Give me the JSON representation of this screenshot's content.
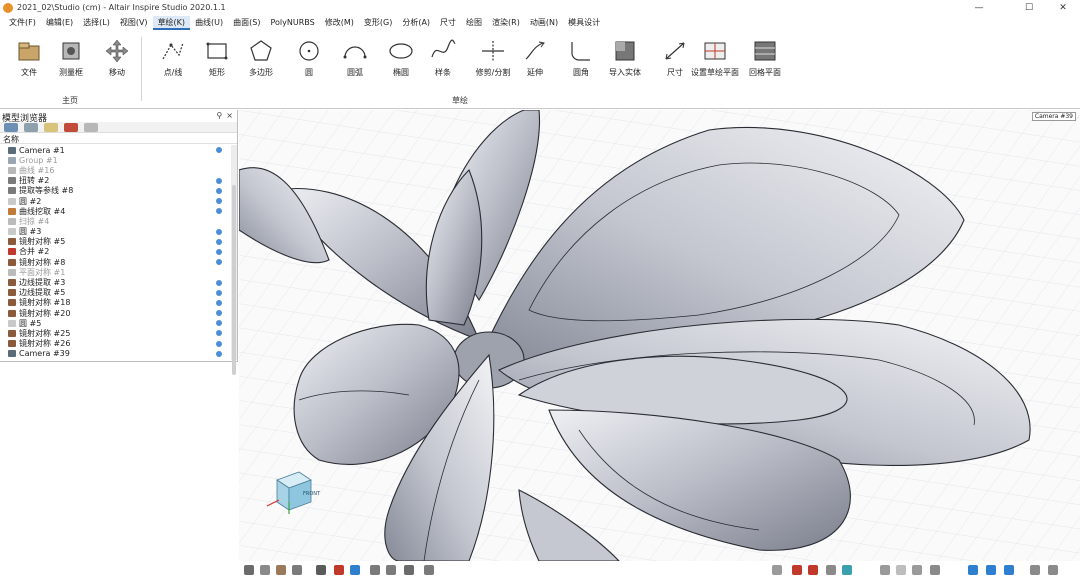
{
  "window": {
    "title": "2021_02\\Studio (cm) - Altair Inspire Studio 2020.1.1",
    "minimize": "—",
    "maximize": "☐",
    "close": "✕"
  },
  "menu": [
    "文件(F)",
    "编辑(E)",
    "选择(L)",
    "视图(V)",
    "草绘(K)",
    "曲线(U)",
    "曲面(S)",
    "PolyNURBS",
    "修改(M)",
    "变形(G)",
    "分析(A)",
    "尺寸",
    "绘图",
    "渲染(R)",
    "动画(N)",
    "模具设计"
  ],
  "active_menu": "草绘(K)",
  "ribbon": {
    "groups": [
      {
        "label": "主页",
        "tools": [
          {
            "label": "文件",
            "icon": "file-folder-icon"
          },
          {
            "label": "测量框",
            "icon": "measure-box-icon"
          },
          {
            "label": "移动",
            "icon": "move-icon"
          }
        ]
      },
      {
        "label": "草绘",
        "tools": [
          {
            "label": "点/线",
            "icon": "point-line-icon"
          },
          {
            "label": "矩形",
            "icon": "rectangle-icon"
          },
          {
            "label": "多边形",
            "icon": "polygon-icon"
          },
          {
            "label": "圆",
            "icon": "circle-icon"
          },
          {
            "label": "圆弧",
            "icon": "arc-icon"
          },
          {
            "label": "椭圆",
            "icon": "ellipse-icon"
          },
          {
            "label": "样条",
            "icon": "spline-icon"
          },
          {
            "label": "修剪/分割",
            "icon": "trim-split-icon"
          },
          {
            "label": "延伸",
            "icon": "extend-icon"
          },
          {
            "label": "圆角",
            "icon": "fillet-icon"
          },
          {
            "label": "导入实体",
            "icon": "import-solid-icon"
          },
          {
            "label": "尺寸",
            "icon": "dimension-icon"
          },
          {
            "label": "设置草绘平面",
            "icon": "set-sketch-plane-icon"
          },
          {
            "label": "回格平面",
            "icon": "grid-plane-icon"
          }
        ]
      }
    ]
  },
  "browser": {
    "title": "模型浏览器",
    "column_header": "名称",
    "items": [
      {
        "label": "Camera #1",
        "dim": false,
        "visible": true,
        "icon_color": "#5a6b7a"
      },
      {
        "label": "Group #1",
        "dim": true,
        "visible": false,
        "icon_color": "#9aa6b2"
      },
      {
        "label": "曲线 #16",
        "dim": true,
        "visible": false,
        "icon_color": "#b8b8b8"
      },
      {
        "label": "扭转 #2",
        "dim": false,
        "visible": true,
        "icon_color": "#7a7a7a"
      },
      {
        "label": "提取等参线 #8",
        "dim": false,
        "visible": true,
        "icon_color": "#7a7a7a"
      },
      {
        "label": "圆 #2",
        "dim": false,
        "visible": true,
        "icon_color": "#c9c9c9"
      },
      {
        "label": "曲线挖取 #4",
        "dim": false,
        "visible": true,
        "icon_color": "#c07a3a"
      },
      {
        "label": "扫掠 #4",
        "dim": true,
        "visible": false,
        "icon_color": "#bbbbbb"
      },
      {
        "label": "圆 #3",
        "dim": false,
        "visible": true,
        "icon_color": "#c9c9c9"
      },
      {
        "label": "镜射对称 #5",
        "dim": false,
        "visible": true,
        "icon_color": "#8a5a3a"
      },
      {
        "label": "合并 #2",
        "dim": false,
        "visible": true,
        "icon_color": "#c0392b"
      },
      {
        "label": "镜射对称 #8",
        "dim": false,
        "visible": true,
        "icon_color": "#8a5a3a"
      },
      {
        "label": "平面对称 #1",
        "dim": true,
        "visible": false,
        "icon_color": "#bbbbbb"
      },
      {
        "label": "边线提取 #3",
        "dim": false,
        "visible": true,
        "icon_color": "#8a5a3a"
      },
      {
        "label": "边线提取 #5",
        "dim": false,
        "visible": true,
        "icon_color": "#8a5a3a"
      },
      {
        "label": "镜射对称 #18",
        "dim": false,
        "visible": true,
        "icon_color": "#8a5a3a"
      },
      {
        "label": "镜射对称 #20",
        "dim": false,
        "visible": true,
        "icon_color": "#8a5a3a"
      },
      {
        "label": "圆 #5",
        "dim": false,
        "visible": true,
        "icon_color": "#c9c9c9"
      },
      {
        "label": "镜射对称 #25",
        "dim": false,
        "visible": true,
        "icon_color": "#8a5a3a"
      },
      {
        "label": "镜射对称 #26",
        "dim": false,
        "visible": true,
        "icon_color": "#8a5a3a"
      },
      {
        "label": "Camera #39",
        "dim": false,
        "visible": true,
        "icon_color": "#5a6b7a"
      }
    ]
  },
  "viewport": {
    "camera_label": "Camera #39",
    "viewcube_face": "FRONT"
  }
}
